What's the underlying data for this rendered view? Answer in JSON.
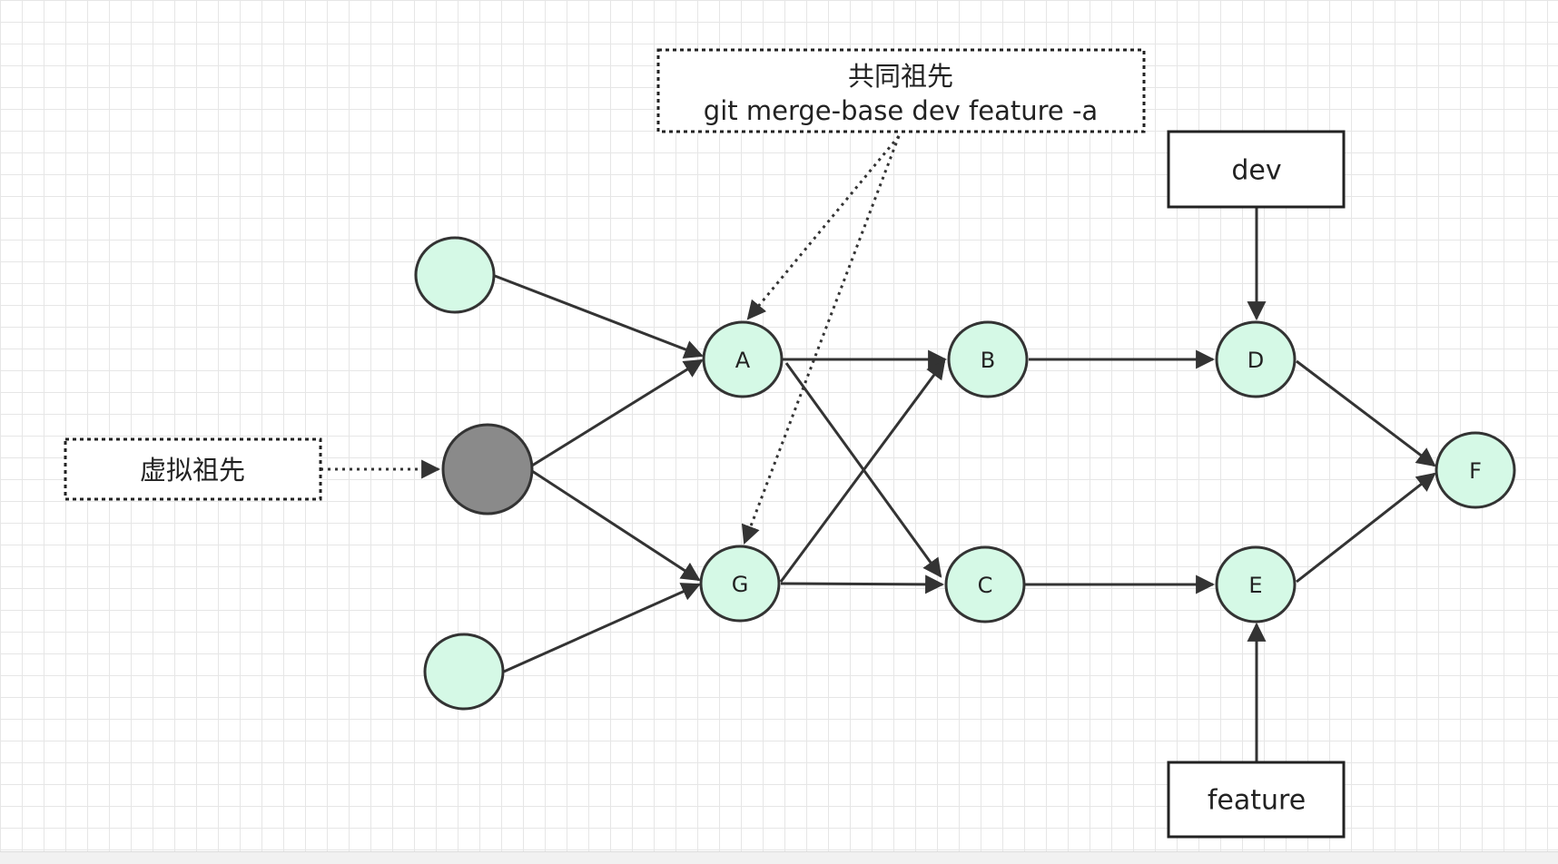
{
  "diagram": {
    "nodes": [
      {
        "id": "A",
        "label": "A"
      },
      {
        "id": "B",
        "label": "B"
      },
      {
        "id": "C",
        "label": "C"
      },
      {
        "id": "D",
        "label": "D"
      },
      {
        "id": "E",
        "label": "E"
      },
      {
        "id": "F",
        "label": "F"
      },
      {
        "id": "G",
        "label": "G"
      },
      {
        "id": "root-top",
        "label": ""
      },
      {
        "id": "root-virtual",
        "label": ""
      },
      {
        "id": "root-bottom",
        "label": ""
      }
    ],
    "edges": [
      {
        "from": "root-top",
        "to": "A"
      },
      {
        "from": "root-virtual",
        "to": "A"
      },
      {
        "from": "root-virtual",
        "to": "G"
      },
      {
        "from": "root-bottom",
        "to": "G"
      },
      {
        "from": "A",
        "to": "B"
      },
      {
        "from": "A",
        "to": "C"
      },
      {
        "from": "G",
        "to": "B"
      },
      {
        "from": "G",
        "to": "C"
      },
      {
        "from": "B",
        "to": "D"
      },
      {
        "from": "C",
        "to": "E"
      },
      {
        "from": "D",
        "to": "F"
      },
      {
        "from": "E",
        "to": "F"
      }
    ],
    "branches": {
      "dev": "dev",
      "feature": "feature"
    },
    "notes": {
      "common_ancestor_title": "共同祖先",
      "common_ancestor_command": "git merge-base dev feature -a",
      "virtual_ancestor": "虚拟祖先"
    },
    "colors": {
      "commit_fill": "#d5f9e6",
      "virtual_fill": "#8a8a8a",
      "stroke": "#333333"
    }
  }
}
